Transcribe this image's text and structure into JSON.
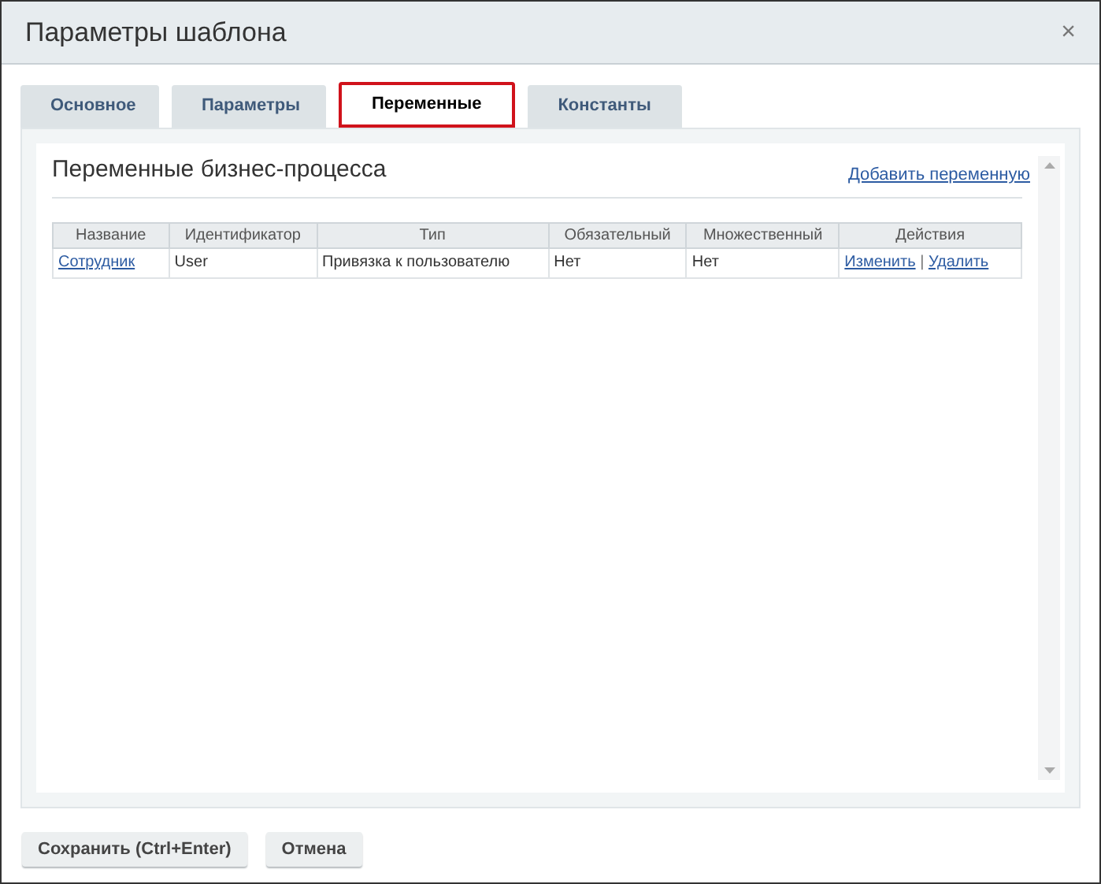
{
  "window": {
    "title": "Параметры шаблона",
    "close": "×"
  },
  "tabs": [
    {
      "label": "Основное",
      "selected": false
    },
    {
      "label": "Параметры",
      "selected": false
    },
    {
      "label": "Переменные",
      "selected": true
    },
    {
      "label": "Константы",
      "selected": false
    }
  ],
  "section": {
    "title": "Переменные бизнес-процесса",
    "add_link": "Добавить переменную"
  },
  "table": {
    "columns": [
      "Название",
      "Идентификатор",
      "Тип",
      "Обязательный",
      "Множественный",
      "Действия"
    ],
    "rows": [
      {
        "name": "Сотрудник",
        "id": "User",
        "type": "Привязка к пользователю",
        "required": "Нет",
        "multiple": "Нет",
        "actions": [
          "Изменить",
          "Удалить"
        ],
        "separator": "|"
      }
    ]
  },
  "buttons": [
    "Сохранить (Ctrl+Enter)",
    "Отмена"
  ]
}
